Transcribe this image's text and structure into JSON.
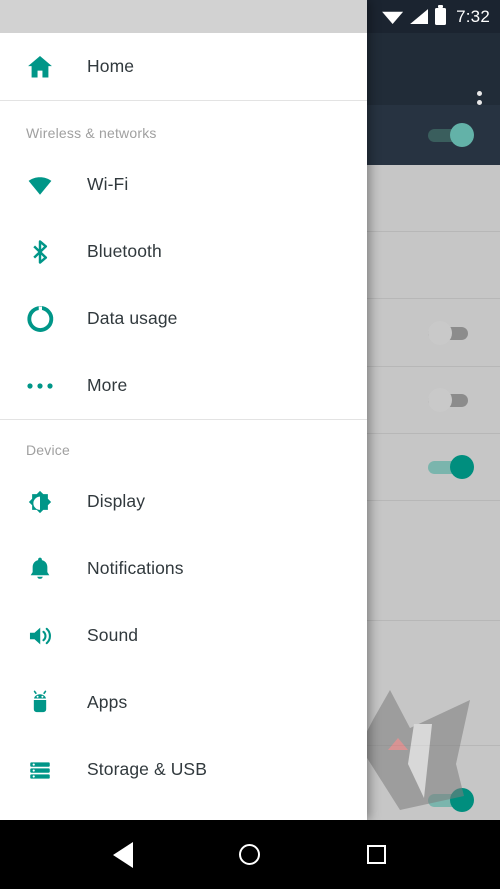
{
  "status_bar": {
    "time": "7:32",
    "icons": [
      "wifi-icon",
      "signal-icon",
      "battery-icon"
    ]
  },
  "theme": {
    "accent_teal": "#009688",
    "drawer_bg": "#ffffff",
    "label_color": "#31393d",
    "section_header_color": "#a0a0a0",
    "dim_scrim": "#c6c6c6",
    "toolbar_dark": "#212c38",
    "navbar_bg": "#000000"
  },
  "drawer": {
    "name": "settings-navigation-drawer",
    "home": {
      "label": "Home",
      "icon": "home-icon"
    },
    "sections": [
      {
        "header": "Wireless & networks",
        "items": [
          {
            "label": "Wi-Fi",
            "icon": "wifi-icon"
          },
          {
            "label": "Bluetooth",
            "icon": "bluetooth-icon"
          },
          {
            "label": "Data usage",
            "icon": "data-usage-icon"
          },
          {
            "label": "More",
            "icon": "more-horizontal-icon"
          }
        ]
      },
      {
        "header": "Device",
        "items": [
          {
            "label": "Display",
            "icon": "brightness-icon"
          },
          {
            "label": "Notifications",
            "icon": "bell-icon"
          },
          {
            "label": "Sound",
            "icon": "volume-icon"
          },
          {
            "label": "Apps",
            "icon": "android-robot-icon"
          },
          {
            "label": "Storage & USB",
            "icon": "storage-icon"
          }
        ]
      }
    ]
  },
  "background_app": {
    "overflow_menu": "overflow-menu-icon",
    "rows": [
      {
        "switch": "on",
        "style": "dim"
      },
      {
        "switch": "none"
      },
      {
        "switch": "none"
      },
      {
        "switch": "off"
      },
      {
        "switch": "off"
      },
      {
        "switch": "on"
      },
      {
        "switch": "none"
      },
      {
        "switch": "on"
      }
    ]
  },
  "navigation_bar": {
    "back": "back-button",
    "home": "home-button",
    "recents": "recents-button"
  }
}
